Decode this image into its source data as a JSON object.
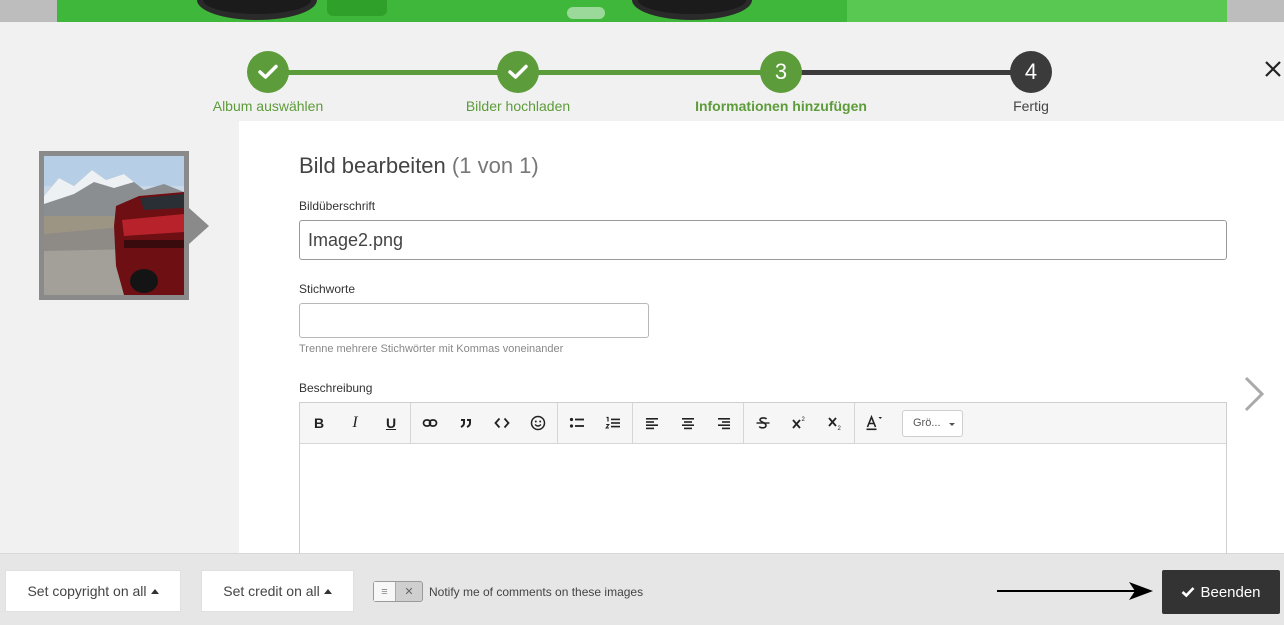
{
  "colors": {
    "accent_green": "#5d9c3a",
    "step_dark": "#3b3b3b",
    "finish_button": "#333333"
  },
  "stepper": {
    "steps": [
      {
        "label": "Album auswählen",
        "state": "done",
        "icon": "check-icon"
      },
      {
        "label": "Bilder hochladen",
        "state": "done",
        "icon": "check-icon"
      },
      {
        "number": "3",
        "label": "Informationen hinzufügen",
        "state": "current"
      },
      {
        "number": "4",
        "label": "Fertig",
        "state": "upcoming"
      }
    ]
  },
  "editor_panel": {
    "title": "Bild bearbeiten",
    "count": "(1 von 1)",
    "caption": {
      "label": "Bildüberschrift",
      "value": "Image2.png"
    },
    "tags": {
      "label": "Stichworte",
      "value": "",
      "hint": "Trenne mehrere Stichwörter mit Kommas voneinander"
    },
    "description": {
      "label": "Beschreibung",
      "toolbar": {
        "bold": "B",
        "italic": "I",
        "underline": "U",
        "size_select": "Grö..."
      }
    }
  },
  "footer": {
    "copyright_button": "Set copyright on all",
    "credit_button": "Set credit on all",
    "notify_label": "Notify me of comments on these images",
    "finish_button": "Beenden"
  }
}
